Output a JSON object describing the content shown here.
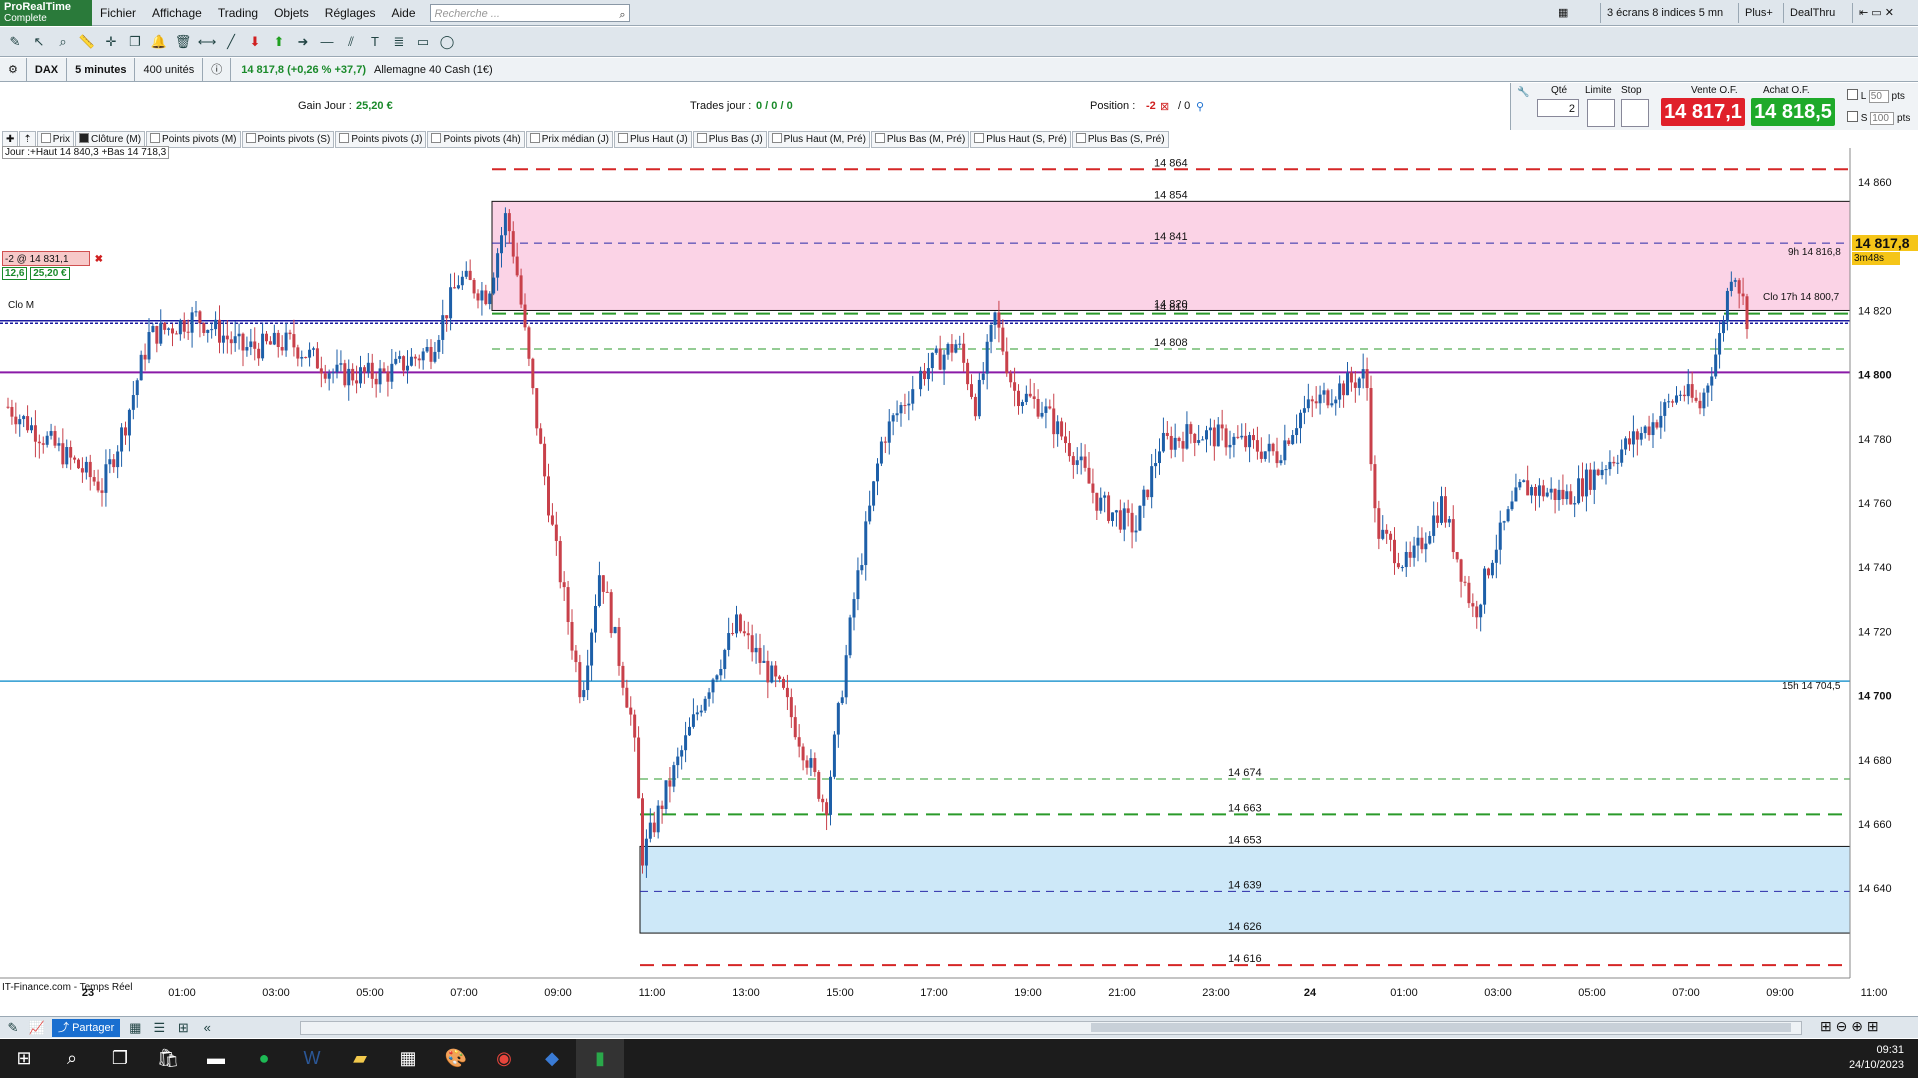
{
  "app": {
    "logo_title": "ProRealTime",
    "logo_sub": "Complete"
  },
  "menu": [
    "Fichier",
    "Affichage",
    "Trading",
    "Objets",
    "Réglages",
    "Aide"
  ],
  "search": {
    "placeholder": "Recherche ..."
  },
  "top_right": {
    "screens": "3 écrans 8 indices 5 mn",
    "plus": "Plus+",
    "dealthru": "DealThru"
  },
  "instrument": {
    "symbol": "DAX",
    "timeframe": "5 minutes",
    "units": "400 unités",
    "price_info": "14 817,8 (+0,26 % +37,7)",
    "name": "Allemagne 40 Cash (1€)"
  },
  "info": {
    "gain_label": "Gain Jour :",
    "gain_value": "25,20 €",
    "trades_label": "Trades jour :",
    "trades_value": "0 / 0 / 0",
    "position_label": "Position :",
    "position_value": "-2",
    "position_extra": "/ 0"
  },
  "order_panel": {
    "qty_label": "Qté",
    "qty_value": "2",
    "limit_label": "Limite",
    "stop_label": "Stop",
    "sell_label": "Vente O.F.",
    "sell_price": "14 817,1",
    "buy_label": "Achat O.F.",
    "buy_price": "14 818,5",
    "l_label": "L",
    "l_value": "50",
    "s_label": "S",
    "s_value": "100",
    "pts": "pts",
    "sell_color": "#e0202a",
    "buy_color": "#1faa2a"
  },
  "indicator_tabs": [
    {
      "label": "Prix",
      "on": false
    },
    {
      "label": "Clôture (M)",
      "on": true
    },
    {
      "label": "Points pivots (M)",
      "on": false
    },
    {
      "label": "Points pivots (S)",
      "on": false
    },
    {
      "label": "Points pivots (J)",
      "on": false
    },
    {
      "label": "Points pivots (4h)",
      "on": false
    },
    {
      "label": "Prix médian (J)",
      "on": false
    },
    {
      "label": "Plus Haut (J)",
      "on": false
    },
    {
      "label": "Plus Bas (J)",
      "on": false
    },
    {
      "label": "Plus Haut (M, Pré)",
      "on": false
    },
    {
      "label": "Plus Bas (M, Pré)",
      "on": false
    },
    {
      "label": "Plus Haut (S, Pré)",
      "on": false
    },
    {
      "label": "Plus Bas (S, Pré)",
      "on": false
    }
  ],
  "chart_labels": {
    "day_summary": "Jour :+Haut 14 840,3 +Bas 14 718,3",
    "position_tag": "-2 @ 14 831,1",
    "pos_left": "12,6",
    "pos_right": "25,20 €",
    "clo_m": "Clo M",
    "clo_17h": "Clo 17h 14 800,7",
    "label_9h": "9h 14 816,8",
    "label_15h": "15h 14 704,5",
    "current_price": "14 817,8",
    "countdown": "3m48s",
    "source": "IT-Finance.com - Temps Réel"
  },
  "chart_data": {
    "type": "candlestick",
    "instrument": "DAX",
    "timeframe": "5 minutes",
    "ylim": [
      14612,
      14870
    ],
    "y_ticks": [
      14860,
      14840,
      14820,
      14800,
      14780,
      14760,
      14740,
      14720,
      14700,
      14680,
      14660,
      14640
    ],
    "y_ticks_bold": [
      14800,
      14700
    ],
    "x_ticks": [
      "23",
      "01:00",
      "03:00",
      "05:00",
      "07:00",
      "09:00",
      "11:00",
      "13:00",
      "15:00",
      "17:00",
      "19:00",
      "21:00",
      "23:00",
      "24",
      "01:00",
      "03:00",
      "05:00",
      "07:00",
      "09:00",
      "11:00",
      "13:00"
    ],
    "close_path": [
      [
        0,
        14790
      ],
      [
        0.8,
        14780
      ],
      [
        1.6,
        14770
      ],
      [
        2.0,
        14765
      ],
      [
        2.5,
        14785
      ],
      [
        3.0,
        14812
      ],
      [
        4.0,
        14818
      ],
      [
        5.0,
        14808
      ],
      [
        6.0,
        14810
      ],
      [
        7.0,
        14800
      ],
      [
        7.5,
        14800
      ],
      [
        8.0,
        14800
      ],
      [
        9.0,
        14808
      ],
      [
        9.6,
        14830
      ],
      [
        10.2,
        14825
      ],
      [
        10.6,
        14850
      ],
      [
        10.8,
        14835
      ],
      [
        11.2,
        14790
      ],
      [
        11.6,
        14750
      ],
      [
        12.2,
        14700
      ],
      [
        12.6,
        14740
      ],
      [
        13.3,
        14690
      ],
      [
        13.5,
        14650
      ],
      [
        14.0,
        14670
      ],
      [
        14.8,
        14700
      ],
      [
        15.5,
        14722
      ],
      [
        16.5,
        14700
      ],
      [
        17.4,
        14665
      ],
      [
        18.0,
        14730
      ],
      [
        18.6,
        14780
      ],
      [
        19.4,
        14800
      ],
      [
        20.2,
        14810
      ],
      [
        20.6,
        14790
      ],
      [
        21.0,
        14818
      ],
      [
        21.4,
        14795
      ],
      [
        22.0,
        14790
      ],
      [
        22.7,
        14775
      ],
      [
        23.2,
        14760
      ],
      [
        24.0,
        14752
      ],
      [
        24.5,
        14778
      ],
      [
        25.2,
        14782
      ],
      [
        26.0,
        14780
      ],
      [
        27.0,
        14775
      ],
      [
        27.5,
        14788
      ],
      [
        28.2,
        14795
      ],
      [
        28.9,
        14800
      ],
      [
        29.1,
        14752
      ],
      [
        29.8,
        14740
      ],
      [
        30.5,
        14760
      ],
      [
        31.2,
        14725
      ],
      [
        31.6,
        14745
      ],
      [
        32.2,
        14765
      ],
      [
        33.2,
        14762
      ],
      [
        34.2,
        14775
      ],
      [
        35.0,
        14785
      ],
      [
        35.6,
        14795
      ],
      [
        36.0,
        14790
      ],
      [
        36.4,
        14810
      ],
      [
        36.7,
        14835
      ],
      [
        37.0,
        14818
      ]
    ],
    "levels": [
      {
        "value": 14864,
        "label": "14 864",
        "color": "#d52626",
        "style": "dashed-thick"
      },
      {
        "value": 14854,
        "label": "14 854",
        "color": "#111111",
        "style": "box-top"
      },
      {
        "value": 14841,
        "label": "14 841",
        "color": "#2a2aa8",
        "style": "dashed"
      },
      {
        "value": 14820,
        "label": "14 820",
        "color": "#111111",
        "style": "box-bottom"
      },
      {
        "value": 14819,
        "label": "14 819",
        "color": "#2a9a2a",
        "style": "dashed-thick"
      },
      {
        "value": 14808,
        "label": "14 808",
        "color": "#2a9a2a",
        "style": "dashed"
      },
      {
        "value": 14674,
        "label": "14 674",
        "color": "#2a9a2a",
        "style": "dashed"
      },
      {
        "value": 14663,
        "label": "14 663",
        "color": "#2a9a2a",
        "style": "dashed-thick"
      },
      {
        "value": 14653,
        "label": "14 653",
        "color": "#111111",
        "style": "box-top"
      },
      {
        "value": 14639,
        "label": "14 639",
        "color": "#2a2aa8",
        "style": "dashed"
      },
      {
        "value": 14626,
        "label": "14 626",
        "color": "#111111",
        "style": "box-bottom"
      },
      {
        "value": 14616,
        "label": "14 616",
        "color": "#d52626",
        "style": "dashed-thick"
      }
    ],
    "horizontal_lines": [
      {
        "value": 14800.7,
        "color": "#8a1aa8",
        "label": "Clo 17h 14 800,7"
      },
      {
        "value": 14704.5,
        "color": "#2a9ad0",
        "label": "15h 14 704,5"
      },
      {
        "value": 14816.8,
        "color": "#1a1aa0",
        "label": "9h 14 816,8"
      },
      {
        "value": 14816.0,
        "color": "#1a1aa0",
        "label": "Clo M"
      }
    ],
    "zones": [
      {
        "from": 14820,
        "to": 14854,
        "color": "#fbd3e6"
      },
      {
        "from": 14626,
        "to": 14653,
        "color": "#cde8f8"
      }
    ],
    "colors": {
      "up": "#1d5fa8",
      "down": "#c8404a",
      "price_tag": "#f5c518"
    }
  },
  "bottom": {
    "share": "Partager"
  },
  "taskbar": {
    "time": "09:31",
    "date": "24/10/2023"
  }
}
